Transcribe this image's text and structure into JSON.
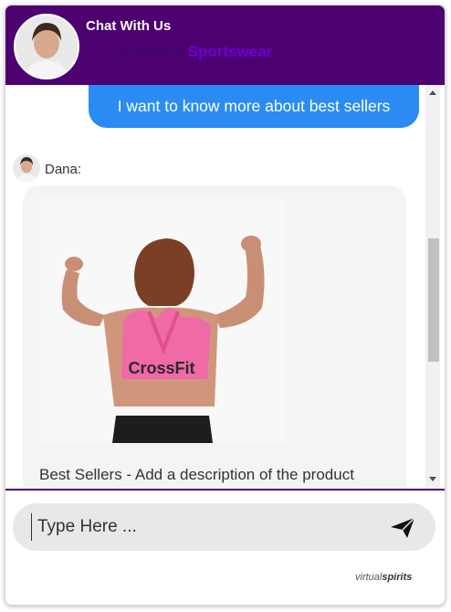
{
  "header": {
    "title": "Chat With Us",
    "subtitle_plain": "Women's",
    "subtitle_strong": "Sportswear",
    "avatar_icon": "agent-avatar-photo"
  },
  "conversation": {
    "user_message": "I want to know more about best sellers",
    "agent_name": "Dana:",
    "product_image_icon": "woman-in-crossfit-sports-bra-photo",
    "product_image_print": "CrossFit",
    "product_caption": "Best Sellers - Add a description of the product"
  },
  "composer": {
    "placeholder": "Type Here ...",
    "send_icon": "paper-plane-icon"
  },
  "branding": {
    "prefix": "virtual",
    "suffix": "spirits"
  },
  "colors": {
    "header_bg": "#4d0070",
    "user_bubble": "#2a8cf2",
    "subtitle_accent": "#6b00d6",
    "agent_bubble": "#f4f4f4",
    "input_bg": "#e8e8e8"
  }
}
